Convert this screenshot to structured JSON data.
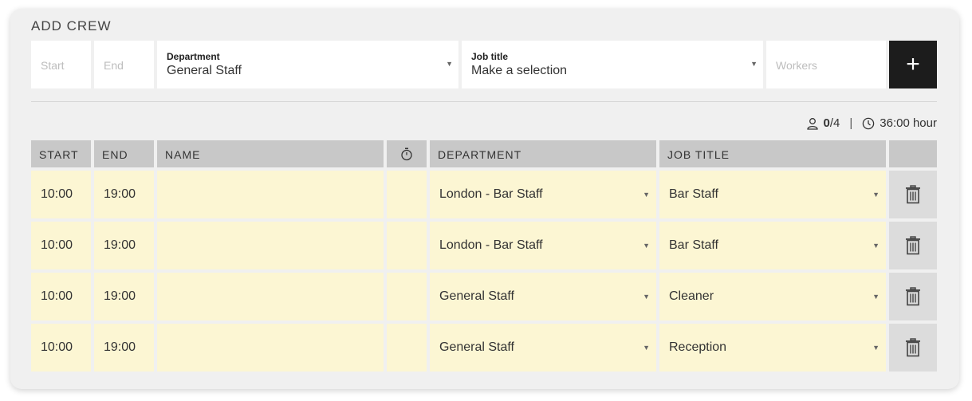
{
  "panel": {
    "title": "ADD CREW"
  },
  "form": {
    "start_placeholder": "Start",
    "end_placeholder": "End",
    "department_label": "Department",
    "department_value": "General Staff",
    "job_title_label": "Job title",
    "job_title_value": "Make a selection",
    "workers_placeholder": "Workers",
    "add_label": "+"
  },
  "summary": {
    "assigned": "0",
    "total": "/4",
    "separator": "|",
    "hours": "36:00 hour"
  },
  "table": {
    "headers": {
      "start": "START",
      "end": "END",
      "name": "NAME",
      "department": "DEPARTMENT",
      "job_title": "JOB TITLE"
    },
    "rows": [
      {
        "start": "10:00",
        "end": "19:00",
        "name": "",
        "department": "London - Bar Staff",
        "job_title": "Bar Staff"
      },
      {
        "start": "10:00",
        "end": "19:00",
        "name": "",
        "department": "London - Bar Staff",
        "job_title": "Bar Staff"
      },
      {
        "start": "10:00",
        "end": "19:00",
        "name": "",
        "department": "General Staff",
        "job_title": "Cleaner"
      },
      {
        "start": "10:00",
        "end": "19:00",
        "name": "",
        "department": "General Staff",
        "job_title": "Reception"
      }
    ]
  },
  "colors": {
    "row_bg": "#fcf6d3",
    "header_bg": "#c8c8c8",
    "button_bg": "#1c1c1c"
  }
}
